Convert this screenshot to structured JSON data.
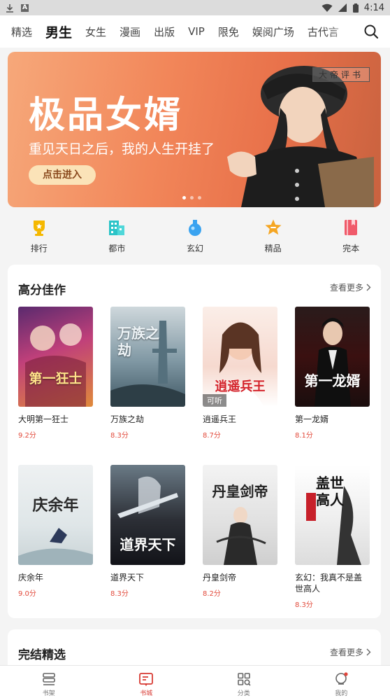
{
  "status_bar": {
    "time": "4:14"
  },
  "top_tabs": [
    "精选",
    "男生",
    "女生",
    "漫画",
    "出版",
    "VIP",
    "限免",
    "娱阅广场",
    "古代言"
  ],
  "active_tab": "男生",
  "banner": {
    "title": "极品女婿",
    "subtitle": "重见天日之后，我的人生开挂了",
    "button": "点击进入",
    "tag": "大帝评书"
  },
  "categories": [
    {
      "label": "排行",
      "icon": "trophy-icon",
      "color": "#f5b800"
    },
    {
      "label": "都市",
      "icon": "city-icon",
      "color": "#2bc4c8"
    },
    {
      "label": "玄幻",
      "icon": "potion-icon",
      "color": "#3aa3f0"
    },
    {
      "label": "精品",
      "icon": "star-icon",
      "color": "#f5a623"
    },
    {
      "label": "完本",
      "icon": "book-icon",
      "color": "#f05a6a"
    }
  ],
  "section1": {
    "title": "高分佳作",
    "more": "查看更多",
    "books": [
      {
        "title": "大明第一狂士",
        "score": "9.2分",
        "cover_text": "第一狂士"
      },
      {
        "title": "万族之劫",
        "score": "8.3分",
        "cover_text": "万族之劫"
      },
      {
        "title": "逍遥兵王",
        "score": "8.7分",
        "cover_text": "逍遥兵王",
        "badge": "可听"
      },
      {
        "title": "第一龙婿",
        "score": "8.1分",
        "cover_text": "第一龙婿"
      },
      {
        "title": "庆余年",
        "score": "9.0分",
        "cover_text": "庆余年"
      },
      {
        "title": "道界天下",
        "score": "8.3分",
        "cover_text": "道界天下"
      },
      {
        "title": "丹皇剑帝",
        "score": "8.2分",
        "cover_text": "丹皇剑帝"
      },
      {
        "title": "玄幻：我真不是盖世高人",
        "score": "8.3分",
        "cover_text": "盖世高人"
      }
    ]
  },
  "section2": {
    "title": "完结精选",
    "more": "查看更多"
  },
  "bottom_nav": [
    {
      "label": "书架",
      "icon": "bookshelf-icon"
    },
    {
      "label": "书城",
      "icon": "bookstore-icon",
      "active": true
    },
    {
      "label": "分类",
      "icon": "category-icon"
    },
    {
      "label": "我的",
      "icon": "profile-icon"
    }
  ]
}
